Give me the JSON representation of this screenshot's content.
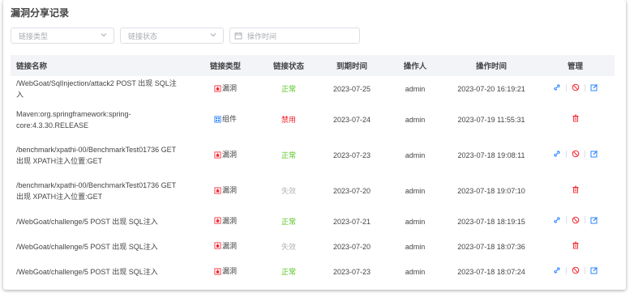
{
  "page": {
    "title": "漏洞分享记录"
  },
  "filters": {
    "link_type_placeholder": "链接类型",
    "link_status_placeholder": "链接状态",
    "op_time_placeholder": "操作时间"
  },
  "table": {
    "columns": [
      "链接名称",
      "链接类型",
      "链接状态",
      "到期时间",
      "操作人",
      "操作时间",
      "管理"
    ],
    "rows": [
      {
        "name": "/WebGoat/SqlInjection/attack2 POST 出现 SQL注入",
        "type": "漏洞",
        "type_icon": "vuln",
        "status": "正常",
        "status_kind": "ok",
        "expire": "2023-07-25",
        "operator": "admin",
        "op_time": "2023-07-20 16:19:21",
        "actions": [
          "link",
          "disable",
          "edit"
        ]
      },
      {
        "name": "Maven:org.springframework:spring-core:4.3.30.RELEASE",
        "type": "组件",
        "type_icon": "component",
        "status": "禁用",
        "status_kind": "off",
        "expire": "2023-07-24",
        "operator": "admin",
        "op_time": "2023-07-19 11:55:31",
        "actions": [
          "delete"
        ]
      },
      {
        "name": "/benchmark/xpathi-00/BenchmarkTest01736 GET 出现 XPATH注入位置:GET",
        "type": "漏洞",
        "type_icon": "vuln",
        "status": "正常",
        "status_kind": "ok",
        "expire": "2023-07-23",
        "operator": "admin",
        "op_time": "2023-07-18 19:08:11",
        "actions": [
          "link",
          "disable",
          "edit"
        ]
      },
      {
        "name": "/benchmark/xpathi-00/BenchmarkTest01736 GET 出现 XPATH注入位置:GET",
        "type": "漏洞",
        "type_icon": "vuln",
        "status": "失效",
        "status_kind": "expired",
        "expire": "2023-07-20",
        "operator": "admin",
        "op_time": "2023-07-18 19:07:10",
        "actions": [
          "delete"
        ]
      },
      {
        "name": "/WebGoat/challenge/5 POST 出现 SQL注入",
        "type": "漏洞",
        "type_icon": "vuln",
        "status": "正常",
        "status_kind": "ok",
        "expire": "2023-07-21",
        "operator": "admin",
        "op_time": "2023-07-18 18:19:15",
        "actions": [
          "link",
          "disable",
          "edit"
        ]
      },
      {
        "name": "/WebGoat/challenge/5 POST 出现 SQL注入",
        "type": "漏洞",
        "type_icon": "vuln",
        "status": "失效",
        "status_kind": "expired",
        "expire": "2023-07-20",
        "operator": "admin",
        "op_time": "2023-07-18 18:07:36",
        "actions": [
          "delete"
        ]
      },
      {
        "name": "/WebGoat/challenge/5 POST 出现 SQL注入",
        "type": "漏洞",
        "type_icon": "vuln",
        "status": "正常",
        "status_kind": "ok",
        "expire": "2023-07-23",
        "operator": "admin",
        "op_time": "2023-07-18 18:07:24",
        "actions": [
          "link",
          "disable",
          "edit"
        ]
      }
    ]
  },
  "colors": {
    "ok": "#52c41a",
    "off": "#f5222d",
    "expired": "#b0b3b8",
    "action_blue": "#1677ff",
    "action_red": "#f5222d"
  }
}
